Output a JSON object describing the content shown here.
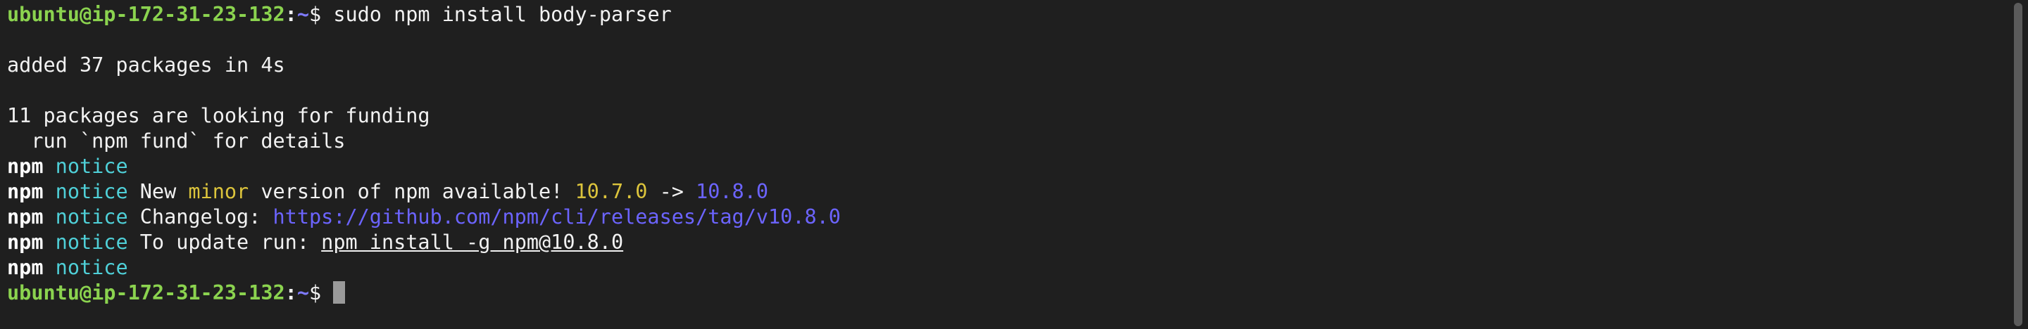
{
  "terminal": {
    "prompt": {
      "user_host": "ubuntu@ip-172-31-23-132",
      "colon": ":",
      "path": "~",
      "dollar": "$ "
    },
    "command": "sudo npm install body-parser",
    "output": {
      "added": "added 37 packages in 4s",
      "funding": "11 packages are looking for funding",
      "fund_hint": "  run `npm fund` for details"
    },
    "notices": {
      "npm": "npm",
      "notice": "notice",
      "new_prefix": " New ",
      "minor": "minor",
      "version_text": " version of npm available! ",
      "old_version": "10.7.0",
      "arrow": " -> ",
      "new_version": "10.8.0",
      "changelog_label": " Changelog: ",
      "changelog_url": "https://github.com/npm/cli/releases/tag/v10.8.0",
      "update_label": " To update run: ",
      "update_command": "npm install -g npm@10.8.0"
    }
  },
  "colors": {
    "background": "#1f1f1f",
    "prompt_user": "#8bd34f",
    "prompt_path": "#7f7bff",
    "notice": "#4fd0d8",
    "minor": "#dcc43c",
    "link": "#6c64ff"
  }
}
